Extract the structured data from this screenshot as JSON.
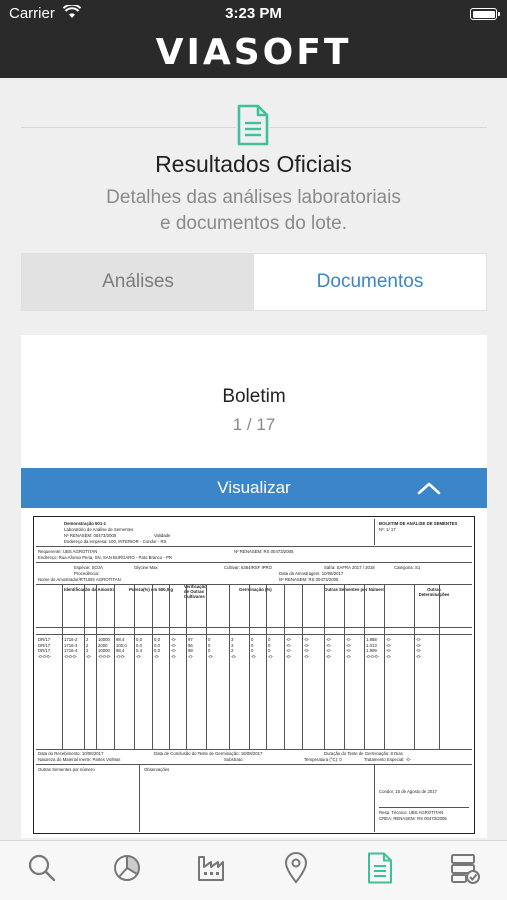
{
  "status_bar": {
    "carrier": "Carrier",
    "time": "3:23 PM"
  },
  "header": {
    "brand": "VIASOFT"
  },
  "intro": {
    "title": "Resultados Oficiais",
    "subtitle_line1": "Detalhes das análises laboratoriais",
    "subtitle_line2": "e documentos do lote."
  },
  "tabs": [
    {
      "label": "Análises",
      "selected": false
    },
    {
      "label": "Documentos",
      "selected": true
    }
  ],
  "card": {
    "title": "Boletim",
    "count": "1 / 17",
    "view_button": "Visualizar"
  },
  "document": {
    "lab_name": "Demonstração 501-1",
    "lab_sub": "Laboratório de Análise de Sementes",
    "lab_renasem": "Nº RENASEM: 00473/2005",
    "lab_validade": "Validade",
    "lab_endereco": "Endereço da empresa: 100, INTERIOR - Condor - RS",
    "doc_title": "BOLETIM DE ANÁLISE DE SEMENTES",
    "doc_number": "Nº: 1/ 17",
    "requerente": "Requerente: UBS AGROTITAN",
    "renasem2": "Nº RENASEM: RS 00473/2005",
    "endereco": "Endereço: Rua Afonso Pena, SN, SAN BURGARO - Pato Branco - PR",
    "especie": "Espécie: SOJA",
    "glycine": "Glycine Max",
    "cultivar": "Cultivar: 6364IRSF IPRO",
    "safra": "Safra: SAFRA 2017 / 2018",
    "categoria": "Categoria: S1",
    "procedencia": "Procedência:",
    "data_amostragem": "Data da Amostragem: 10/08/2017",
    "amostrador": "Nome do Amostrador/RT:UBS AGROTITAN",
    "renasem3": "Nº RENASEM: RS 00473/2005",
    "col_ident": "Identificação da Amostra",
    "col_pureza": "Pureza(%) em 500,0 g",
    "col_verif": "Verificação de Outras Cultivares",
    "col_germ": "Germinação (%)",
    "col_outras": "Outras Sementes por Número",
    "col_outras_det": "Outras Determinações",
    "rows": [
      [
        "DR/17",
        "1716-2",
        "2",
        "10000",
        "98,4",
        "0,0",
        "0,0",
        "-0-",
        "97",
        "0",
        "3",
        "0",
        "0",
        "-0-",
        "-0-",
        "-0-",
        "-0-",
        "1.988",
        "-0-",
        "-0-"
      ],
      [
        "DR/17",
        "1716-3",
        "2",
        "2000",
        "100,0",
        "0,0",
        "0,0",
        "-0-",
        "96",
        "0",
        "3",
        "0",
        "0",
        "-0-",
        "-0-",
        "-0-",
        "-0-",
        "1.013",
        "-0-",
        "-0-"
      ],
      [
        "DR/17",
        "1716-4",
        "2",
        "10000",
        "98,4",
        "0,4",
        "0,0",
        "-0-",
        "98",
        "0",
        "2",
        "0",
        "0",
        "-0-",
        "-0-",
        "-0-",
        "-0-",
        "1.909",
        "-0-",
        "-0-"
      ],
      [
        "-0-0-0-",
        "-0-0-0-",
        "-0-",
        "-0-0-0-",
        "-0-0-",
        "-0-",
        "-0-",
        "-0-",
        "-0-",
        "-0-",
        "-0-",
        "-0-",
        "-0-",
        "-0-",
        "-0-",
        "-0-",
        "-0-",
        "-0-0-0-",
        "-0-",
        "-0-"
      ]
    ],
    "data_recebimento": "Data do Recebimento: 10/08/2017",
    "data_conclusao": "Data de Conclusão do Teste de Germinação: 18/08/2017",
    "duracao": "Duração do Teste de Germinação: 8 Dias",
    "natureza": "Natureza do Material Inerte: Partes Vs/Mas",
    "substrato": "Substrato:",
    "temperatura": "Temperatura (°C): 0",
    "tratamento": "Tratamento Especial: -0-",
    "outras_sementes": "Outras Sementes por número",
    "observacoes": "Observações",
    "condor": "Condor, 15 de Agosto de 2017",
    "resp_tecnico": "Resp. Técnico: UBS AGROTITAN",
    "crea": "CREA: RENASEM: RS 00473/2005"
  },
  "bottom_nav": [
    {
      "icon": "search-icon",
      "active": false
    },
    {
      "icon": "pie-chart-icon",
      "active": false
    },
    {
      "icon": "factory-icon",
      "active": false
    },
    {
      "icon": "map-pin-icon",
      "active": false
    },
    {
      "icon": "document-icon",
      "active": true
    },
    {
      "icon": "server-check-icon",
      "active": false
    }
  ],
  "colors": {
    "accent": "#3b86c8",
    "green": "#3ec09a",
    "header_bg": "#2a2a2a"
  }
}
